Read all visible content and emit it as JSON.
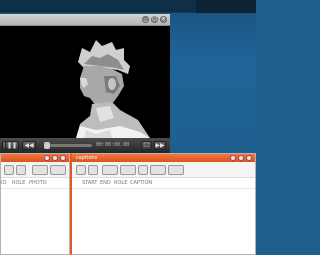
{
  "video_player": {
    "window_buttons": [
      "_",
      "□",
      "×"
    ],
    "controls": {
      "play_label": "▶",
      "pause_label": "❚❚",
      "prev_label": "◀◀",
      "next_label": "▶▶",
      "timecode": "00:00:00.00",
      "fullscreen_label": "⛶"
    }
  },
  "left_panel": {
    "title": "",
    "columns": [
      "IO",
      "ROLE",
      "PHOTO"
    ]
  },
  "main_panel": {
    "title": "captions",
    "columns": [
      "START",
      "END",
      "ROLE",
      "CAPTION"
    ]
  },
  "colors": {
    "accent": "#e05a26",
    "desktop": "#1e5f8e"
  }
}
